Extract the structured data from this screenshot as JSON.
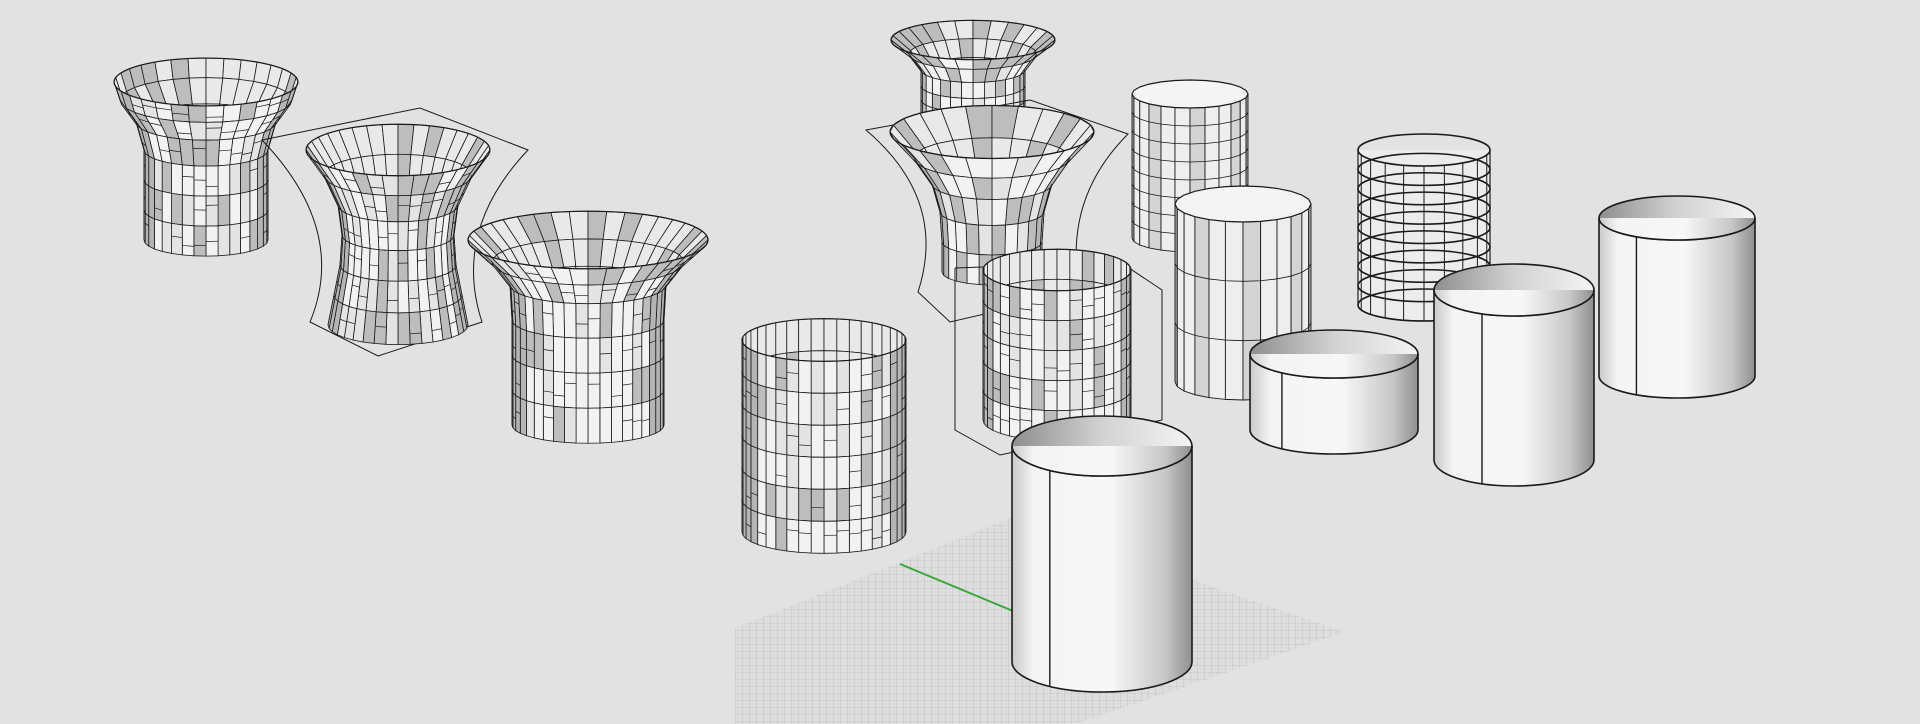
{
  "viewport": {
    "background": "#e2e2e2",
    "line_color": "#1a1a1a",
    "grid_color": "#8f969b",
    "axis_x_color": "#c04040",
    "axis_y_color": "#3aa53a",
    "panel_face": "#f2f2f2",
    "panel_shade": "#bdbdbd",
    "objects": [
      "paneled-vase-small",
      "paneled-hourglass",
      "paneled-flared-vase",
      "paneled-cylinder-front",
      "flared-vase-top-center",
      "flared-vase-bounding-box",
      "paneled-cylinder-boxed",
      "faceted-cylinder-ribbed",
      "faceted-cylinder-plain",
      "wire-cylinder-grid",
      "smooth-cylinder-low",
      "smooth-cylinder-medium",
      "smooth-cylinder-tall",
      "smooth-cylinder-selected",
      "construction-plane-grid"
    ]
  }
}
